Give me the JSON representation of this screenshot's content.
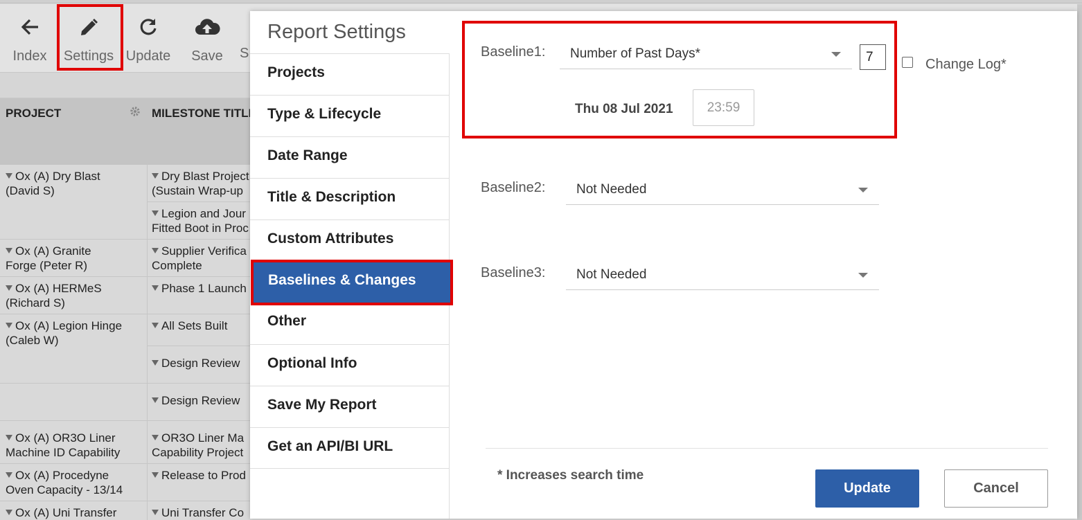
{
  "toolbar": {
    "index_label": "Index",
    "settings_label": "Settings",
    "update_label": "Update",
    "save_label": "Save",
    "partial_label": "S"
  },
  "grid": {
    "columns": {
      "project": "PROJECT",
      "milestone": "MILESTONE TITLE"
    },
    "rows": {
      "r1": {
        "project_l1": "Ox (A) Dry Blast",
        "project_l2": "(David S)",
        "ms_l1": "Dry Blast Project",
        "ms_l2": "(Sustain Wrap-up"
      },
      "r2": {
        "ms_l1": "Legion and Jour",
        "ms_l2": "Fitted Boot in Proc"
      },
      "r3": {
        "project_l1": "Ox (A) Granite",
        "project_l2": "Forge (Peter R)",
        "ms_l1": "Supplier Verifica",
        "ms_l2": "Complete"
      },
      "r4": {
        "project_l1": "Ox (A) HERMeS",
        "project_l2": "(Richard S)",
        "ms_l1": "Phase 1 Launch"
      },
      "r5": {
        "project_l1": "Ox (A) Legion Hinge",
        "project_l2": "(Caleb W)",
        "ms_l1": "All Sets Built"
      },
      "r6": {
        "ms_l1": "Design Review"
      },
      "r7": {
        "ms_l1": "Design Review"
      },
      "r8": {
        "project_l1": "Ox (A) OR3O Liner",
        "project_l2": "Machine ID Capability",
        "ms_l1": "OR3O Liner Ma",
        "ms_l2": "Capability Project"
      },
      "r9": {
        "project_l1": "Ox (A) Procedyne",
        "project_l2": "Oven Capacity - 13/14",
        "ms_l1": "Release to Prod"
      },
      "r10": {
        "project_l1": "Ox (A) Uni Transfer",
        "ms_l1": "Uni Transfer Co"
      }
    }
  },
  "modal": {
    "title": "Report Settings",
    "nav": [
      {
        "label": "Projects"
      },
      {
        "label": "Type & Lifecycle"
      },
      {
        "label": "Date Range"
      },
      {
        "label": "Title & Description"
      },
      {
        "label": "Custom Attributes"
      },
      {
        "label": "Baselines & Changes",
        "active": true
      },
      {
        "label": "Other"
      },
      {
        "label": "Optional Info"
      },
      {
        "label": "Save My Report"
      },
      {
        "label": "Get an API/BI URL"
      }
    ],
    "baseline1": {
      "label": "Baseline1:",
      "selected": "Number of Past Days*",
      "days": "7",
      "date": "Thu 08 Jul 2021",
      "time": "23:59"
    },
    "change_log": {
      "label": "Change Log*",
      "checked": false
    },
    "baseline2": {
      "label": "Baseline2:",
      "selected": "Not Needed"
    },
    "baseline3": {
      "label": "Baseline3:",
      "selected": "Not Needed"
    },
    "footer_note": "* Increases search time",
    "update_label": "Update",
    "cancel_label": "Cancel"
  },
  "colors": {
    "primary": "#2d5fa8",
    "highlight": "#e00000"
  }
}
